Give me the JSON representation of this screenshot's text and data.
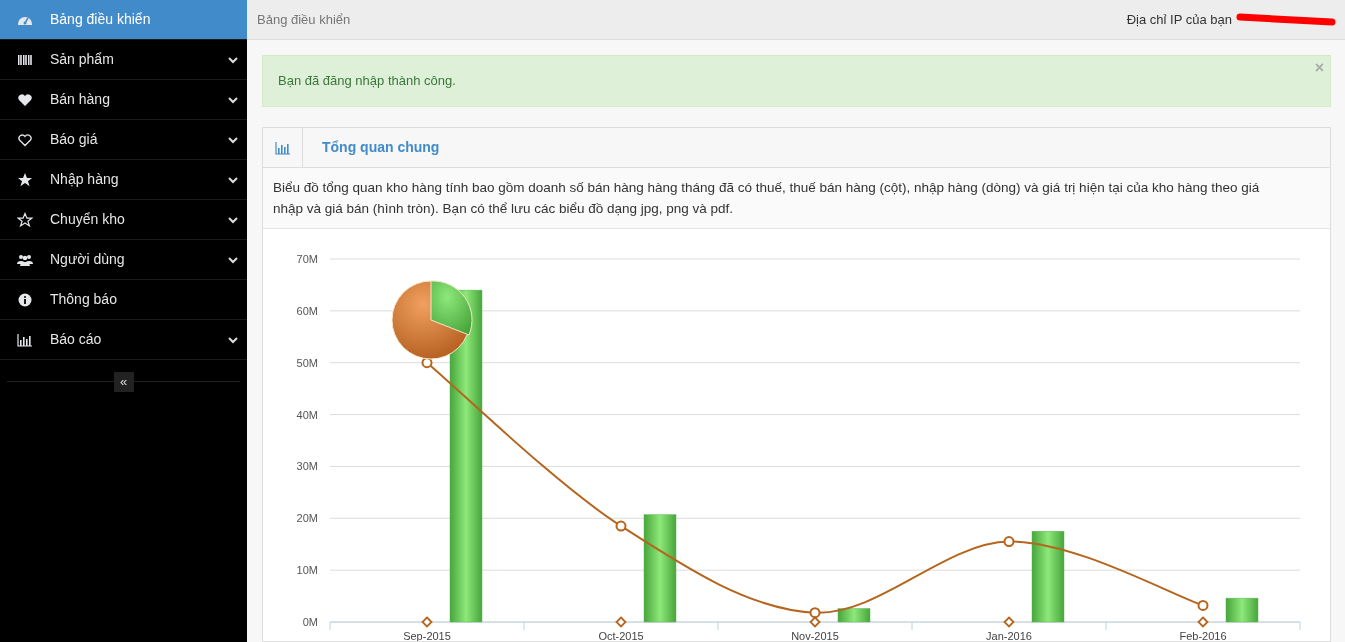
{
  "sidebar": {
    "items": [
      {
        "label": "Bảng điều khiển",
        "kind": "dashboard",
        "selected": true,
        "expandable": false
      },
      {
        "label": "Sản phẩm",
        "kind": "barcode",
        "selected": false,
        "expandable": true
      },
      {
        "label": "Bán hàng",
        "kind": "heart",
        "selected": false,
        "expandable": true
      },
      {
        "label": "Báo giá",
        "kind": "heart-outline",
        "selected": false,
        "expandable": true
      },
      {
        "label": "Nhập hàng",
        "kind": "star",
        "selected": false,
        "expandable": true
      },
      {
        "label": "Chuyển kho",
        "kind": "star-outline",
        "selected": false,
        "expandable": true
      },
      {
        "label": "Người dùng",
        "kind": "users",
        "selected": false,
        "expandable": true
      },
      {
        "label": "Thông báo",
        "kind": "info",
        "selected": false,
        "expandable": false
      },
      {
        "label": "Báo cáo",
        "kind": "chart",
        "selected": false,
        "expandable": true
      }
    ],
    "collapse": "«"
  },
  "header": {
    "breadcrumb": "Bảng điều khiển",
    "ip_label": "Địa chỉ IP của bạn"
  },
  "alert": {
    "message": "Bạn đã đăng nhập thành công.",
    "close": "×"
  },
  "panel": {
    "title": "Tổng quan chung",
    "description": "Biểu đồ tổng quan kho hàng tính bao gồm doanh số bán hàng hàng tháng đã có thuế, thuế bán hàng (cột), nhập hàng (dòng) và giá trị hiện tại của kho hàng theo giá nhập và giá bán (hình tròn). Bạn có thể lưu các biểu đồ dạng jpg, png và pdf.",
    "chart_data": {
      "type": "bar",
      "categories": [
        "Sep-2015",
        "Oct-2015",
        "Nov-2015",
        "Jan-2016",
        "Feb-2016"
      ],
      "series": [
        {
          "color": "#5cb85c",
          "values": [
            64000000,
            20700000,
            2600000,
            17500000,
            4600000
          ]
        },
        {
          "type": "line",
          "color": "#b5651d",
          "marker": "circle",
          "values": [
            50000000,
            18500000,
            1800000,
            15500000,
            3200000
          ]
        },
        {
          "type": "scatter",
          "color": "#b5651d",
          "values": [
            0,
            0,
            0,
            0,
            0
          ]
        }
      ],
      "grid": true,
      "ylim": [
        0,
        70000000
      ],
      "yticks": [
        {
          "value": 0,
          "label": "0M"
        },
        {
          "value": 10000000,
          "label": "10M"
        },
        {
          "value": 20000000,
          "label": "20M"
        },
        {
          "value": 30000000,
          "label": "30M"
        },
        {
          "value": 40000000,
          "label": "40M"
        },
        {
          "value": 50000000,
          "label": "50M"
        },
        {
          "value": 60000000,
          "label": "60M"
        },
        {
          "value": 70000000,
          "label": "70M"
        }
      ]
    }
  }
}
